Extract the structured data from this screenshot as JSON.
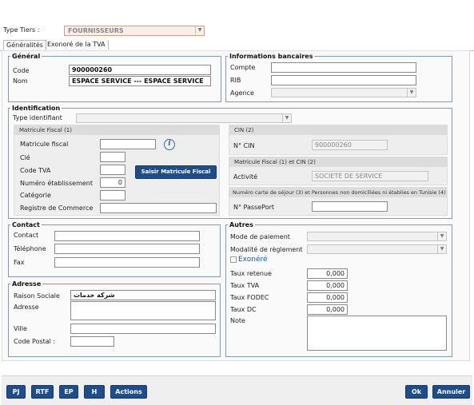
{
  "header": {
    "type_tiers_label": "Type Tiers :",
    "type_tiers_value": "FOURNISSEURS"
  },
  "tabs": [
    {
      "label": "Généralités",
      "active": true
    },
    {
      "label": "Exonoré de la TVA",
      "active": false
    }
  ],
  "general": {
    "title": "Général",
    "code_label": "Code",
    "code_value": "900000260",
    "nom_label": "Nom",
    "nom_value": "ESPACE SERVICE --- ESPACE SERVICE"
  },
  "bank": {
    "title": "Informations bancaires",
    "compte_label": "Compte",
    "rib_label": "RIB",
    "agence_label": "Agence"
  },
  "identification": {
    "title": "Identification",
    "type_label": "Type identifiant",
    "mf_header": "Matricule Fiscal (1)",
    "mf_label": "Matricule fiscal",
    "cle_label": "Clé",
    "code_tva_label": "Code TVA",
    "num_etab_label": "Numéro établissement",
    "num_etab_value": "0",
    "categorie_label": "Catégorie",
    "registre_label": "Registre de Commerce",
    "saisir_button": "Saisir Matricule Fiscal",
    "cin_header": "CIN (2)",
    "cin_label": "N° CIN",
    "cin_value": "900000260",
    "mfcin_header": "Matricule Fiscal (1) et CIN (2)",
    "activite_label": "Activité",
    "activite_value": "SOCIETE DE SERVICE",
    "carte_header": "Numéro carte de séjour (3) et Personnes non domiciliées ni établies en Tunisie (4)",
    "passeport_label": "N° PassePort"
  },
  "contact": {
    "title": "Contact",
    "contact_label": "Contact",
    "tel_label": "Téléphone",
    "fax_label": "Fax"
  },
  "adresse": {
    "title": "Adresse",
    "raison_label": "Raison Sociale",
    "raison_value": "شركة خدمات",
    "adresse_label": "Adresse",
    "ville_label": "Ville",
    "cp_label": "Code Postal :"
  },
  "autres": {
    "title": "Autres",
    "mode_label": "Mode de paiement",
    "modalite_label": "Modalité de règlement",
    "exonere_label": "Exonéré",
    "taux_retenue_label": "Taux retenue",
    "taux_retenue_value": "0,000",
    "taux_tva_label": "Taux TVA",
    "taux_tva_value": "0,000",
    "taux_fodec_label": "Taux FODEC",
    "taux_fodec_value": "0,000",
    "taux_dc_label": "Taux DC",
    "taux_dc_value": "0,000",
    "note_label": "Note"
  },
  "footer": {
    "pj": "PJ",
    "rtf": "RTF",
    "ep": "EP",
    "h": "H",
    "actions": "Actions",
    "ok": "Ok",
    "annuler": "Annuler"
  },
  "colors": {
    "button_bg": "#1e4d8c",
    "group_border": "#7f9db9",
    "info_icon": "#2f6fb5"
  }
}
